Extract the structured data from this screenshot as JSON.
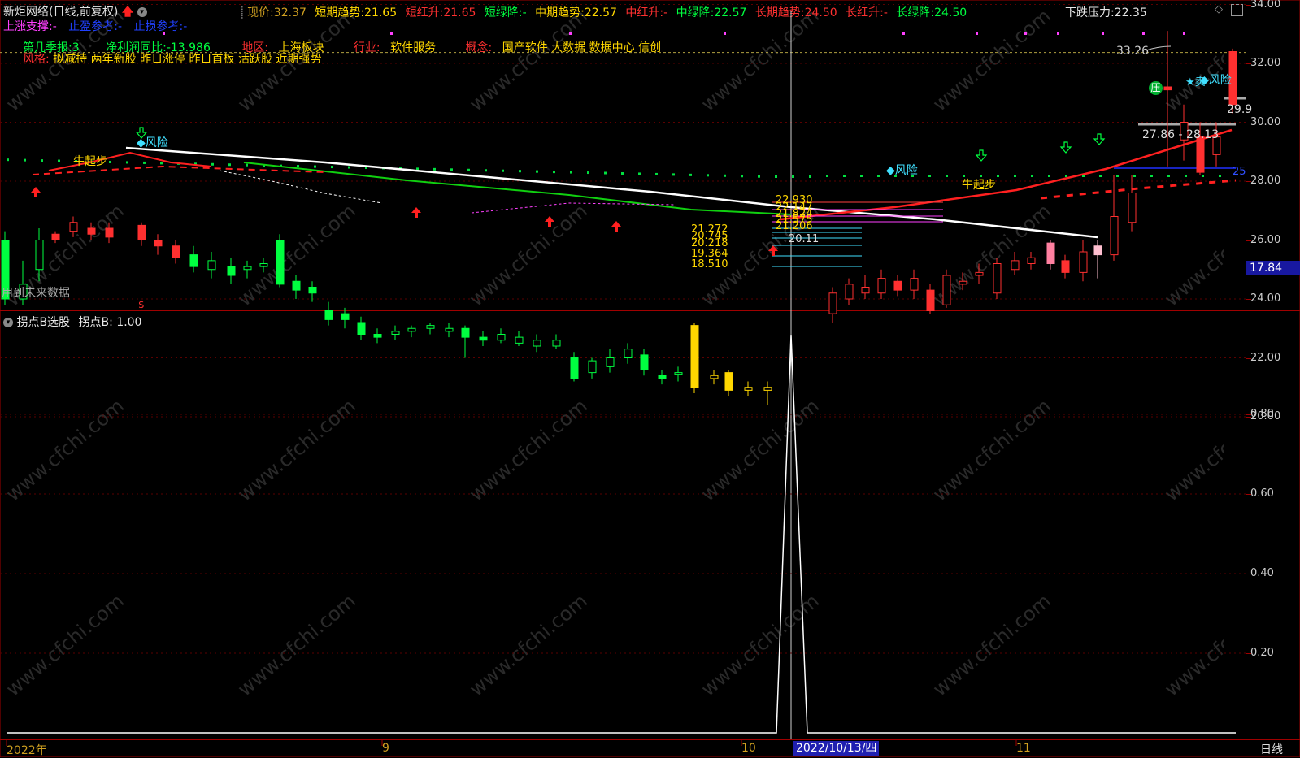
{
  "header": {
    "title": "新炬网络(日线,前复权)",
    "price_label": "现价:",
    "price_value": "32.37",
    "short_trend_label": "短期趋势:",
    "short_trend_value": "21.65",
    "short_red_label": "短红升:",
    "short_red_value": "21.65",
    "short_green_label": "短绿降:",
    "short_green_value": "-",
    "mid_trend_label": "中期趋势:",
    "mid_trend_value": "22.57",
    "mid_red_label": "中红升:",
    "mid_red_value": "-",
    "mid_green_label": "中绿降:",
    "mid_green_value": "22.57",
    "long_trend_label": "长期趋势:",
    "long_trend_value": "24.50",
    "long_red_label": "长红升:",
    "long_red_value": "-",
    "long_green_label": "长绿降:",
    "long_green_value": "24.50",
    "pressure_label": "下跌压力:",
    "pressure_value": "22.35"
  },
  "row2": {
    "support_label": "上涨支撑:",
    "support_value": "-",
    "take_profit_label": "止盈参考:",
    "take_profit_value": "-",
    "stop_loss_label": "止损参考:",
    "stop_loss_value": "-"
  },
  "info": {
    "report_label": "第几季报:",
    "report_value": "3",
    "profit_label": "净利润同比:",
    "profit_value": "-13.986",
    "region_label": "地区:",
    "region_value": "上海板块",
    "industry_label": "行业:",
    "industry_value": "软件服务",
    "concept_label": "概念:",
    "concept_value": "国产软件 大数据 数据中心 信创",
    "risk_label": "风格:",
    "risk_value": "拟减持 两年新股 昨日涨停 昨日首板 活跃股 近期强势"
  },
  "annotations": {
    "risk1": "◆风险",
    "risk2": "◆风险",
    "risk3": "◆风险",
    "bull1": "牛起步",
    "bull2": "牛起步",
    "high_price": "33.26",
    "range": "27.86 - 28.13",
    "right_val": "29.9",
    "low_val": "20.11",
    "press_label": "压",
    "sell_label": "★卖",
    "level_values": [
      "22.930",
      "22.147",
      "21.824",
      "21.575",
      "21.206",
      "21.272",
      "20.745",
      "20.218",
      "19.364",
      "18.510"
    ],
    "current_price_box": "17.84",
    "dollar": "$",
    "blue_right": "25"
  },
  "main_axis": [
    "34.00",
    "32.00",
    "30.00",
    "28.00",
    "26.00",
    "24.00",
    "22.00",
    "20.00"
  ],
  "future_note": "用到未来数据",
  "indicator": {
    "title": "拐点B选股",
    "value_label": "拐点B:",
    "value": "1.00",
    "axis": [
      "0.80",
      "0.60",
      "0.40",
      "0.20"
    ]
  },
  "xaxis": {
    "labels": [
      "2022年",
      "9",
      "10",
      "11"
    ],
    "cursor_date": "2022/10/13/四",
    "period": "日线"
  },
  "watermark": "www.cfchi.com",
  "colors": {
    "up": "#ff3030",
    "down": "#00ff40",
    "yellow": "#ffd700",
    "cyan": "#40e0ff",
    "magenta": "#ff40ff",
    "border": "#a00000"
  }
}
